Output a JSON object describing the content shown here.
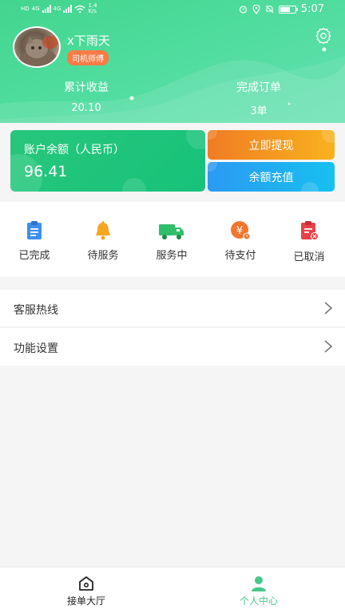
{
  "status_bar": {
    "sim1": "HD",
    "sim2": "HD",
    "net1": "4G",
    "net2": "4G",
    "speed_value": "1.4",
    "speed_unit": "K/s",
    "battery_level": 0.6,
    "time": "5:07"
  },
  "profile": {
    "username": "x下雨天",
    "role": "司机师傅"
  },
  "stats": {
    "earnings_label": "累计收益",
    "earnings_value": "20.10",
    "orders_label": "完成订单",
    "orders_value": "3单"
  },
  "wallet": {
    "balance_label": "账户余额（人民币）",
    "balance_value": "96.41",
    "withdraw_label": "立即提现",
    "recharge_label": "余额充值"
  },
  "order_status": [
    {
      "label": "已完成",
      "icon": "clipboard-icon",
      "color": "#3b8ff0"
    },
    {
      "label": "待服务",
      "icon": "bell-icon",
      "color": "#f5a623"
    },
    {
      "label": "服务中",
      "icon": "truck-icon",
      "color": "#2fbf6b"
    },
    {
      "label": "待支付",
      "icon": "yuan-coin-icon",
      "color": "#f2762e"
    },
    {
      "label": "已取消",
      "icon": "cancel-clipboard-icon",
      "color": "#e8414a"
    }
  ],
  "menu": {
    "hotline_label": "客服热线",
    "settings_label": "功能设置"
  },
  "tabbar": {
    "hall_label": "接单大厅",
    "me_label": "个人中心",
    "active": "me",
    "active_color": "#45c98b"
  }
}
